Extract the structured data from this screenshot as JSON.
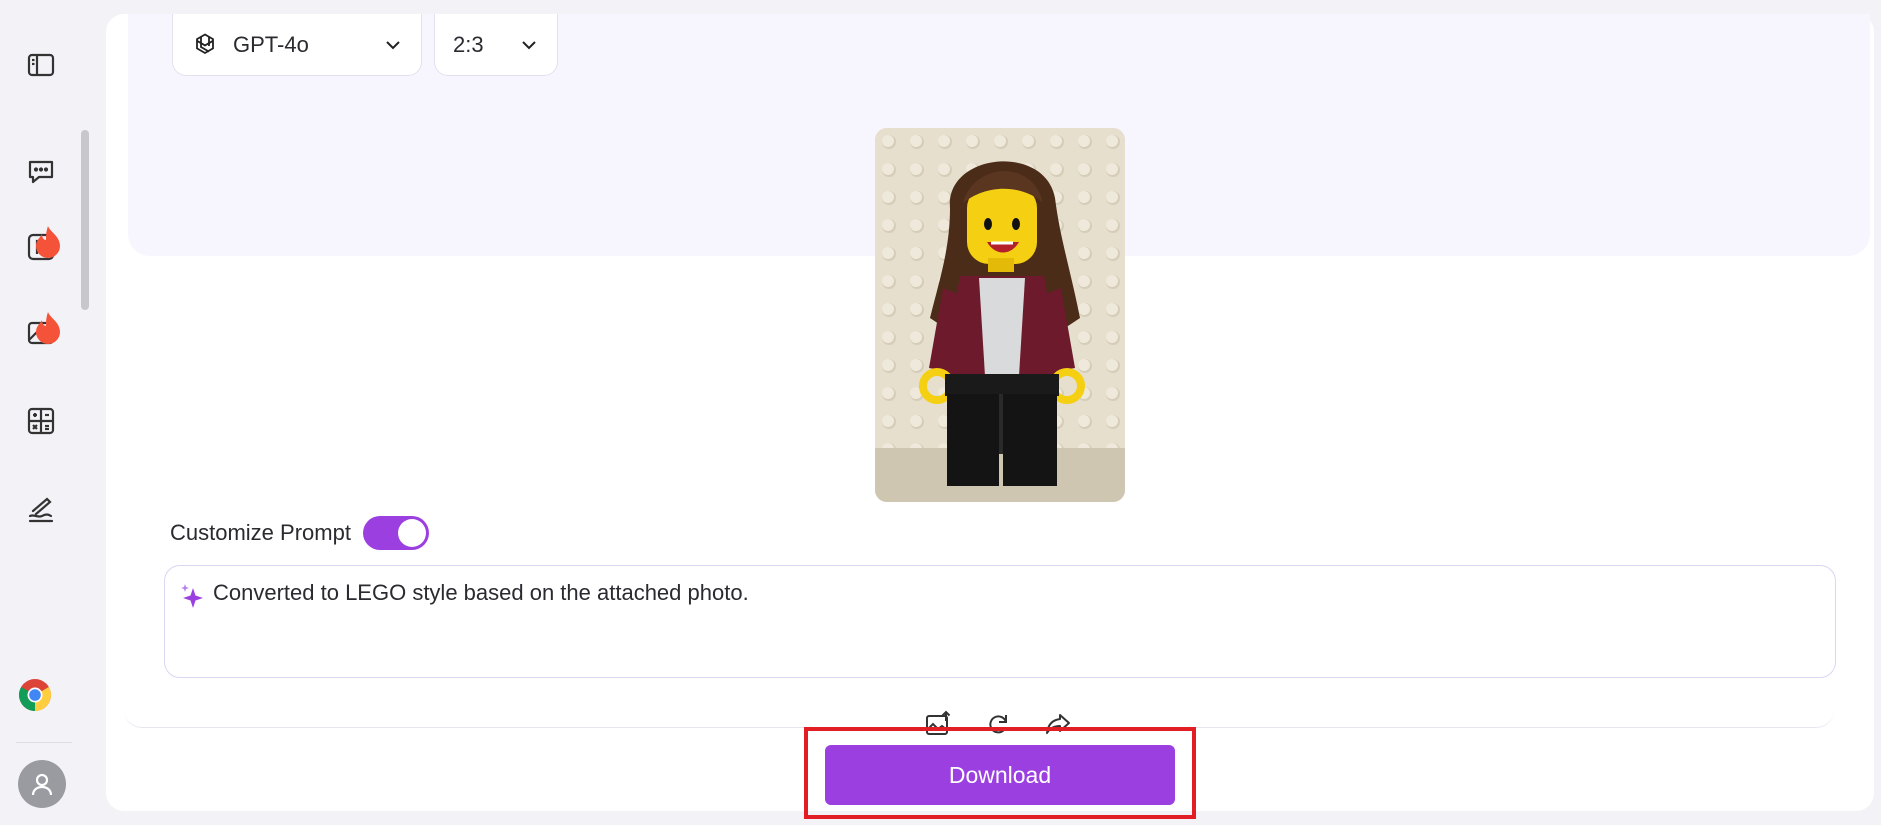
{
  "sidebar": {
    "items": [
      {
        "icon": "sidebar-toggle-icon"
      },
      {
        "icon": "chat-icon"
      },
      {
        "icon": "presentation-icon",
        "hot": true
      },
      {
        "icon": "image-icon",
        "hot": true
      },
      {
        "icon": "calculator-icon"
      },
      {
        "icon": "write-icon"
      }
    ],
    "bottom": [
      {
        "icon": "chrome-icon"
      },
      {
        "icon": "user-avatar-icon"
      }
    ]
  },
  "model_select": {
    "value": "GPT-4o",
    "icon": "openai-logo-icon"
  },
  "ratio_select": {
    "value": "2:3"
  },
  "result_image": {
    "alt": "LEGO style minifigure"
  },
  "customize_prompt": {
    "label": "Customize Prompt",
    "enabled": true
  },
  "prompt": {
    "value": "Converted to LEGO style based on the attached photo."
  },
  "actions": [
    {
      "icon": "upload-image-icon"
    },
    {
      "icon": "regenerate-icon"
    },
    {
      "icon": "share-icon"
    }
  ],
  "download": {
    "label": "Download"
  },
  "colors": {
    "accent": "#9b3fe0",
    "highlight": "#e01e24",
    "panel_bg": "#f7f6ff",
    "page_bg": "#f3f3f7"
  }
}
